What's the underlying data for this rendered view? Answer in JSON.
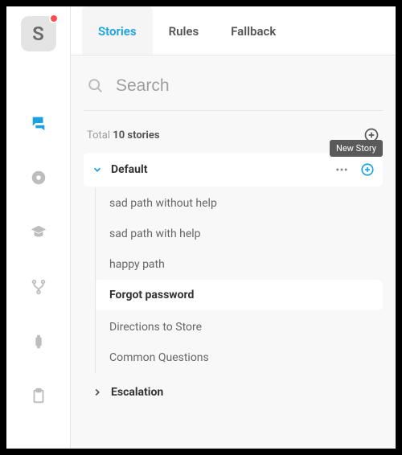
{
  "logo": {
    "letter": "S"
  },
  "tabs": [
    {
      "label": "Stories",
      "active": true
    },
    {
      "label": "Rules",
      "active": false
    },
    {
      "label": "Fallback",
      "active": false
    }
  ],
  "search": {
    "placeholder": "Search"
  },
  "total": {
    "prefix": "Total",
    "count": "10 stories"
  },
  "tooltip": {
    "new_story": "New Story"
  },
  "groups": [
    {
      "name": "Default",
      "expanded": true,
      "items": [
        {
          "label": "sad path without help",
          "active": false
        },
        {
          "label": "sad path with help",
          "active": false
        },
        {
          "label": "happy path",
          "active": false
        },
        {
          "label": "Forgot password",
          "active": true
        },
        {
          "label": "Directions to Store",
          "active": false
        },
        {
          "label": "Common Questions",
          "active": false
        }
      ]
    },
    {
      "name": "Escalation",
      "expanded": false
    }
  ]
}
